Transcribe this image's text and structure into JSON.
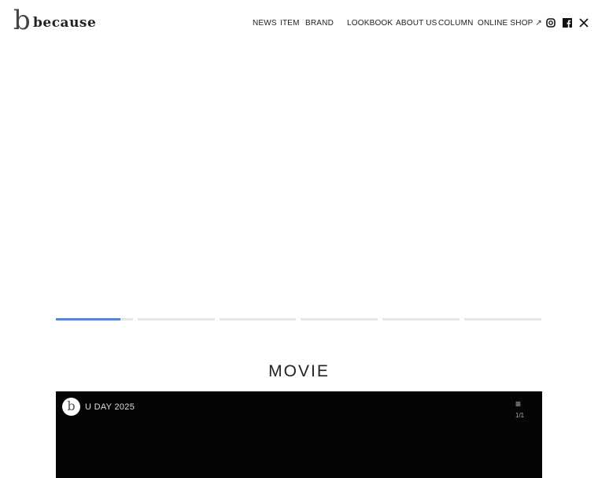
{
  "header": {
    "logo_mark": "b",
    "logo_text": "because",
    "nav": [
      "NEWS",
      "ITEM",
      "BRAND",
      "LOOKBOOK",
      "ABOUT US",
      "COLUMN",
      "ONLINE SHOP"
    ],
    "social": [
      "instagram-icon",
      "facebook-icon",
      "x-icon"
    ]
  },
  "slider": {
    "count": 6,
    "active": 0,
    "active_progress": 0.84,
    "accent": "#5b83d3"
  },
  "movie": {
    "heading": "MOVIE",
    "channel_mark": "b",
    "title": "U DAY 2025",
    "playlist_count": "1/1"
  }
}
